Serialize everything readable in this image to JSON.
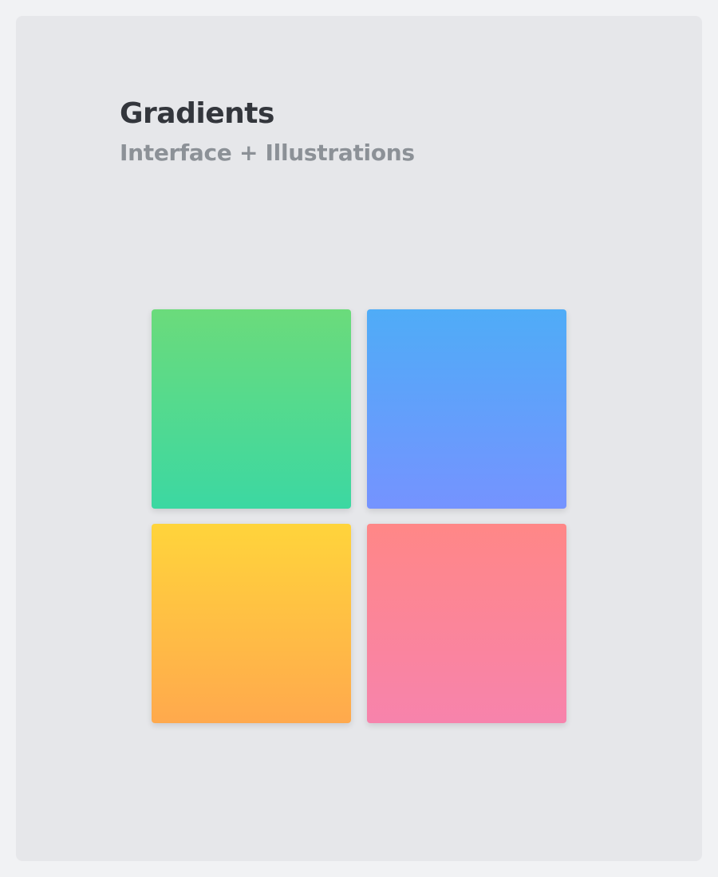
{
  "header": {
    "title": "Gradients",
    "subtitle": "Interface + Illustrations"
  },
  "swatches": [
    {
      "name": "green-gradient-swatch",
      "from": "#6bdb7b",
      "to": "#3cd8a2"
    },
    {
      "name": "blue-gradient-swatch",
      "from": "#4facf7",
      "to": "#7593ff"
    },
    {
      "name": "yellow-gradient-swatch",
      "from": "#ffd43b",
      "to": "#ffa94d"
    },
    {
      "name": "pink-gradient-swatch",
      "from": "#ff8787",
      "to": "#f783ac"
    }
  ]
}
